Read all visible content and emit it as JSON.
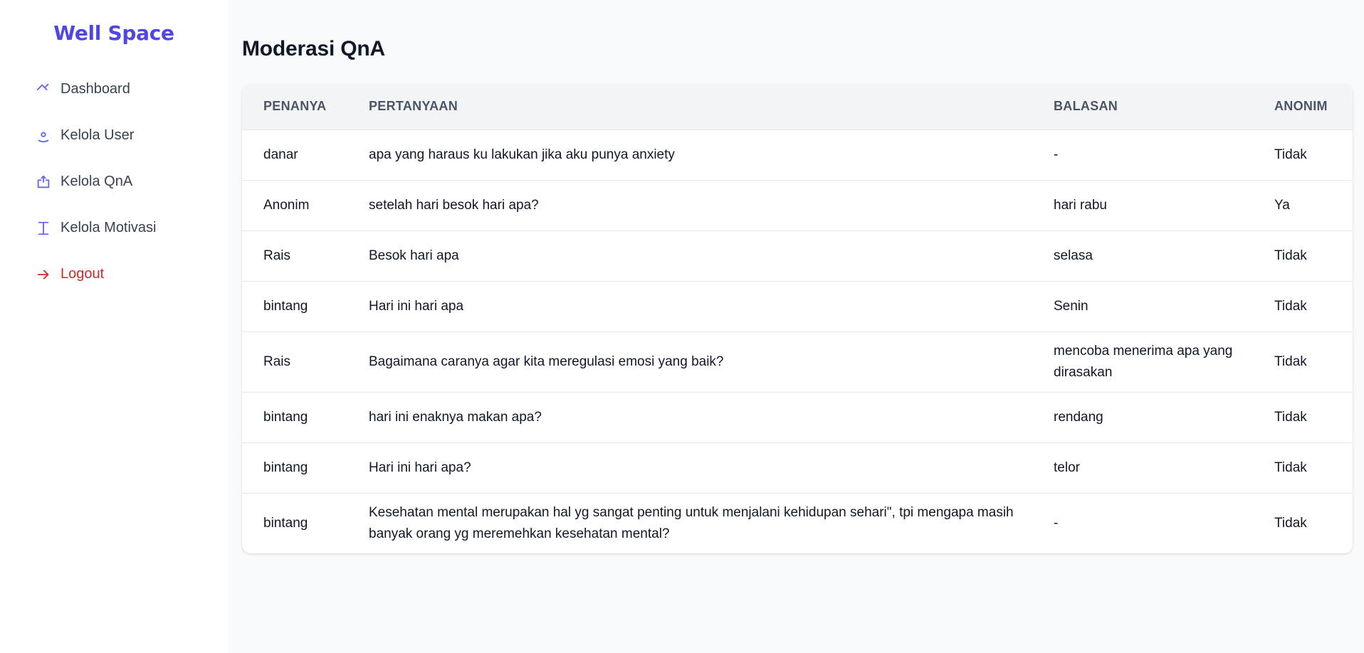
{
  "brand": "Well Space",
  "nav": [
    {
      "label": "Dashboard",
      "icon": "home-icon"
    },
    {
      "label": "Kelola User",
      "icon": "user-icon"
    },
    {
      "label": "Kelola QnA",
      "icon": "tray-icon"
    },
    {
      "label": "Kelola Motivasi",
      "icon": "text-cursor-icon"
    },
    {
      "label": "Logout",
      "icon": "arrow-right-icon"
    }
  ],
  "colors": {
    "brand": "#4f46e5",
    "logout": "#dc2626",
    "icon": "#6366f1"
  },
  "page_title": "Moderasi QnA",
  "table": {
    "headers": [
      "PENANYA",
      "PERTANYAAN",
      "BALASAN",
      "ANONIM"
    ],
    "rows": [
      [
        "danar",
        "apa yang haraus ku lakukan jika aku punya anxiety",
        "-",
        "Tidak"
      ],
      [
        "Anonim",
        "setelah hari besok hari apa?",
        "hari rabu",
        "Ya"
      ],
      [
        "Rais",
        "Besok hari apa",
        "selasa",
        "Tidak"
      ],
      [
        "bintang",
        "Hari ini hari apa",
        "Senin",
        "Tidak"
      ],
      [
        "Rais",
        "Bagaimana caranya agar kita meregulasi emosi yang baik?",
        "mencoba menerima apa yang dirasakan",
        "Tidak"
      ],
      [
        "bintang",
        "hari ini enaknya makan apa?",
        "rendang",
        "Tidak"
      ],
      [
        "bintang",
        "Hari ini hari apa?",
        "telor",
        "Tidak"
      ],
      [
        "bintang",
        "Kesehatan mental merupakan hal yg sangat penting untuk menjalani kehidupan sehari\", tpi mengapa masih banyak orang yg meremehkan kesehatan mental?",
        "-",
        "Tidak"
      ]
    ]
  }
}
